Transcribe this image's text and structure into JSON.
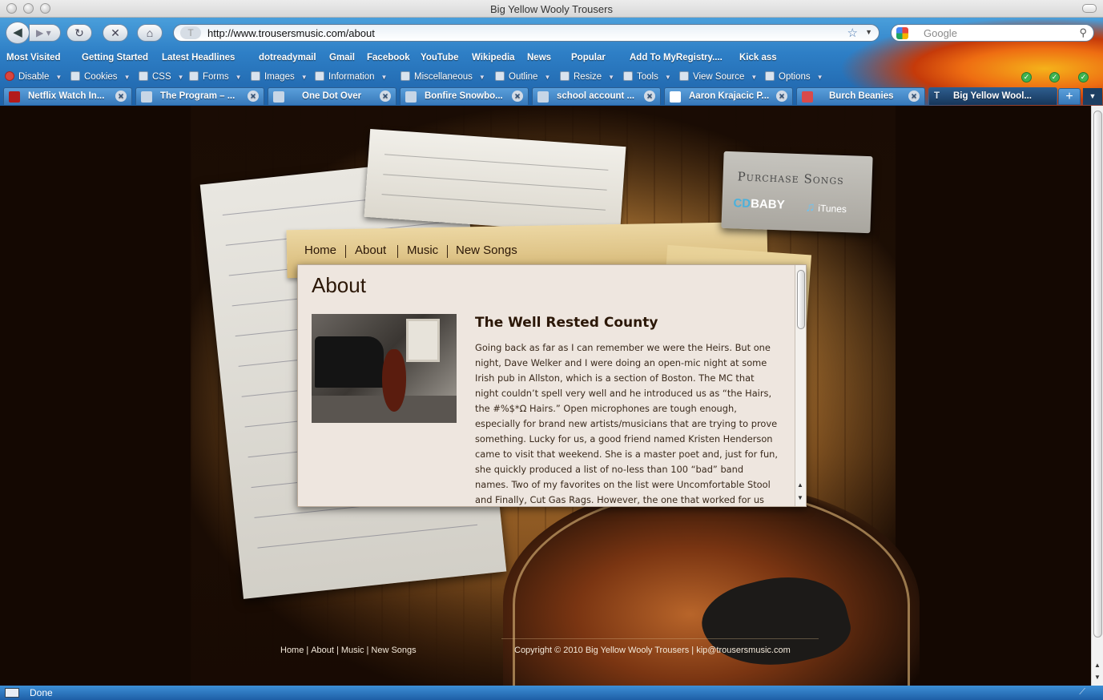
{
  "window": {
    "title": "Big Yellow Wooly Trousers"
  },
  "toolbar": {
    "url": "http://www.trousersmusic.com/about",
    "search_placeholder": "Google"
  },
  "bookmarks": [
    "Most Visited",
    "Getting Started",
    "Latest Headlines",
    "dotreadymail",
    "Gmail",
    "Facebook",
    "YouTube",
    "Wikipedia",
    "News",
    "Popular",
    "Add To MyRegistry....",
    "Kick ass"
  ],
  "devtools": [
    "Disable",
    "Cookies",
    "CSS",
    "Forms",
    "Images",
    "Information",
    "Miscellaneous",
    "Outline",
    "Resize",
    "Tools",
    "View Source",
    "Options"
  ],
  "tabs": [
    {
      "label": "Netflix Watch In...",
      "active": false
    },
    {
      "label": "The Program – ...",
      "active": false
    },
    {
      "label": "One Dot Over",
      "active": false
    },
    {
      "label": "Bonfire Snowbo...",
      "active": false
    },
    {
      "label": "school account ...",
      "active": false
    },
    {
      "label": "Aaron Krajacic P...",
      "active": false
    },
    {
      "label": "Burch Beanies",
      "active": false
    },
    {
      "label": "Big Yellow Wool...",
      "active": true
    }
  ],
  "site": {
    "purchase_title": "Purchase Songs",
    "cdbaby_cd": "CD",
    "cdbaby_baby": "BABY",
    "itunes": "iTunes",
    "nav": [
      "Home",
      "About",
      "Music",
      "New Songs"
    ],
    "page_title": "About",
    "article_title": "The Well Rested County",
    "article_body": "Going back as far as I can remember we were the Heirs. But one night, Dave Welker and I were doing an open-mic night at some Irish pub in Allston, which is a section of Boston. The MC that night couldn’t spell very well and he introduced us as “the Hairs, the #%$*Ω Hairs.” Open microphones are tough enough, especially for brand new artists/musicians that are trying to prove something. Lucky for us, a good friend named Kristen Henderson came to visit that weekend. She is a master poet and, just for fun, she quickly produced a list of no-less than 100 “bad” band names. Two of my favorites on the list were Uncomfortable Stool and Finally, Cut Gas Rags. However, the one that worked for us the best was The Well Rested County. The only slight flaw with the name was the word",
    "footer_nav": [
      "Home",
      "About",
      "Music",
      "New Songs"
    ],
    "copyright": "Copyright © 2010 Big Yellow Wooly Trousers | kip@trousersmusic.com"
  },
  "status": {
    "text": "Done"
  },
  "colors": {
    "chrome": "#2e7fc6",
    "panel_bg": "#eee6df",
    "text_dark": "#2b1707",
    "footer_text": "#f3e9da"
  }
}
